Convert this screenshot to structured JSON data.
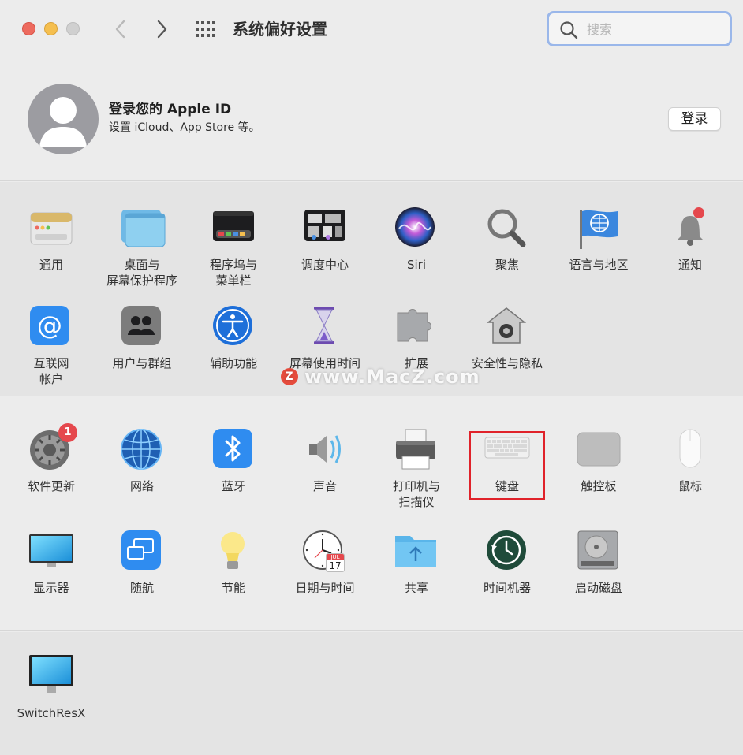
{
  "window": {
    "title": "系统偏好设置"
  },
  "search": {
    "placeholder": "搜索"
  },
  "apple_id": {
    "title": "登录您的 Apple ID",
    "subtitle": "设置 iCloud、App Store 等。",
    "login_label": "登录"
  },
  "section1": [
    {
      "label": "通用",
      "icon": "general-icon"
    },
    {
      "label": "桌面与\n屏幕保护程序",
      "icon": "desktop-icon"
    },
    {
      "label": "程序坞与\n菜单栏",
      "icon": "dock-icon"
    },
    {
      "label": "调度中心",
      "icon": "mission-control-icon"
    },
    {
      "label": "Siri",
      "icon": "siri-icon"
    },
    {
      "label": "聚焦",
      "icon": "spotlight-icon"
    },
    {
      "label": "语言与地区",
      "icon": "language-icon"
    },
    {
      "label": "通知",
      "icon": "notifications-icon"
    },
    {
      "label": "互联网\n帐户",
      "icon": "internet-accounts-icon"
    },
    {
      "label": "用户与群组",
      "icon": "users-icon"
    },
    {
      "label": "辅助功能",
      "icon": "accessibility-icon"
    },
    {
      "label": "屏幕使用时间",
      "icon": "screen-time-icon"
    },
    {
      "label": "扩展",
      "icon": "extensions-icon"
    },
    {
      "label": "安全性与隐私",
      "icon": "security-icon"
    }
  ],
  "section2": [
    {
      "label": "软件更新",
      "icon": "software-update-icon",
      "badge": "1"
    },
    {
      "label": "网络",
      "icon": "network-icon"
    },
    {
      "label": "蓝牙",
      "icon": "bluetooth-icon"
    },
    {
      "label": "声音",
      "icon": "sound-icon"
    },
    {
      "label": "打印机与\n扫描仪",
      "icon": "printer-icon"
    },
    {
      "label": "键盘",
      "icon": "keyboard-icon"
    },
    {
      "label": "触控板",
      "icon": "trackpad-icon"
    },
    {
      "label": "鼠标",
      "icon": "mouse-icon"
    },
    {
      "label": "显示器",
      "icon": "displays-icon"
    },
    {
      "label": "随航",
      "icon": "sidecar-icon"
    },
    {
      "label": "节能",
      "icon": "energy-saver-icon"
    },
    {
      "label": "日期与时间",
      "icon": "date-time-icon",
      "calendar_day": "17",
      "calendar_month": "JUL"
    },
    {
      "label": "共享",
      "icon": "sharing-icon"
    },
    {
      "label": "时间机器",
      "icon": "time-machine-icon"
    },
    {
      "label": "启动磁盘",
      "icon": "startup-disk-icon"
    }
  ],
  "section3": [
    {
      "label": "SwitchResX",
      "icon": "switchresx-icon"
    }
  ],
  "watermark": {
    "text": "www.MacZ.com",
    "logo": "Z"
  },
  "colors": {
    "highlight": "#e0222a",
    "badge": "#e5484d",
    "search_focus": "#9ab7ea"
  }
}
